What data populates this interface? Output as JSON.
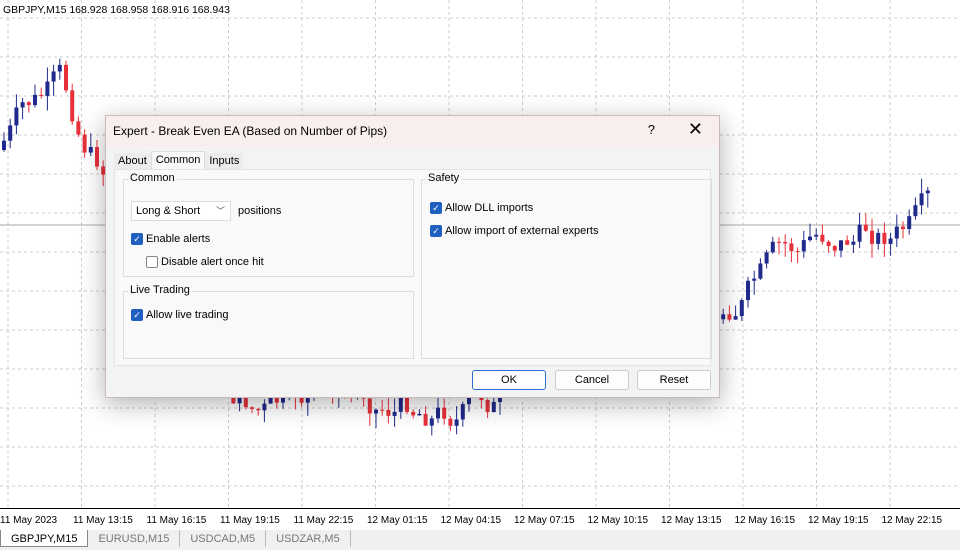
{
  "chart": {
    "symbol_label": "GBPJPY,M15  168.928 168.958 168.916 168.943",
    "bull_color": "#1f2a8c",
    "bear_color": "#e8303a",
    "time_labels": [
      "11 May 2023",
      "11 May 13:15",
      "11 May 16:15",
      "11 May 19:15",
      "11 May 22:15",
      "12 May 01:15",
      "12 May 04:15",
      "12 May 07:15",
      "12 May 10:15",
      "12 May 13:15",
      "12 May 16:15",
      "12 May 19:15",
      "12 May 22:15"
    ]
  },
  "tabs": [
    "GBPJPY,M15",
    "EURUSD,M15",
    "USDCAD,M5",
    "USDZAR,M5"
  ],
  "dialog": {
    "title": "Expert - Break Even EA (Based on Number of Pips)",
    "help": "?",
    "close": "✕",
    "tabs": [
      "About",
      "Common",
      "Inputs"
    ],
    "common": {
      "legend": "Common",
      "positions_value": "Long & Short",
      "positions_label": "positions",
      "enable_alerts": "Enable alerts",
      "disable_alert": "Disable alert once hit"
    },
    "live": {
      "legend": "Live Trading",
      "allow_live": "Allow live trading"
    },
    "safety": {
      "legend": "Safety",
      "allow_dll": "Allow DLL imports",
      "allow_import": "Allow import of external experts"
    },
    "check": "✓",
    "buttons": {
      "ok": "OK",
      "cancel": "Cancel",
      "reset": "Reset"
    }
  }
}
